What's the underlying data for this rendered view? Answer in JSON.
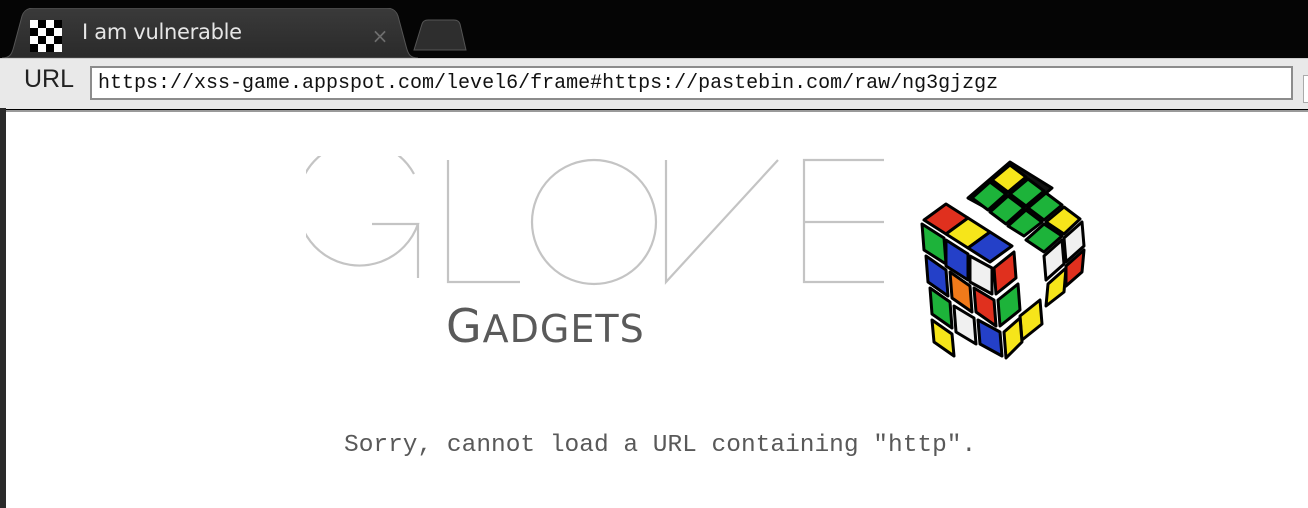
{
  "tab": {
    "title": "I am vulnerable",
    "close_symbol": "×",
    "favicon": "checker-favicon-icon"
  },
  "toolbar": {
    "url_label": "URL",
    "url_value": "https://xss-game.appspot.com/level6/frame#https://pastebin.com/raw/ng3gjzgz"
  },
  "page": {
    "logo_title": "GLOVE",
    "logo_subtitle": "Gadgets",
    "logo_image": "rubiks-cube-icon",
    "message": "Sorry, cannot load a URL containing \"http\"."
  },
  "colors": {
    "tab_background": "#2b2b2b",
    "chrome_background": "#050505",
    "toolbar_background": "#e9e9e9",
    "message_text": "#595959",
    "logo_stroke": "#c8c8c8",
    "subtitle_text": "#5a5a5a"
  }
}
